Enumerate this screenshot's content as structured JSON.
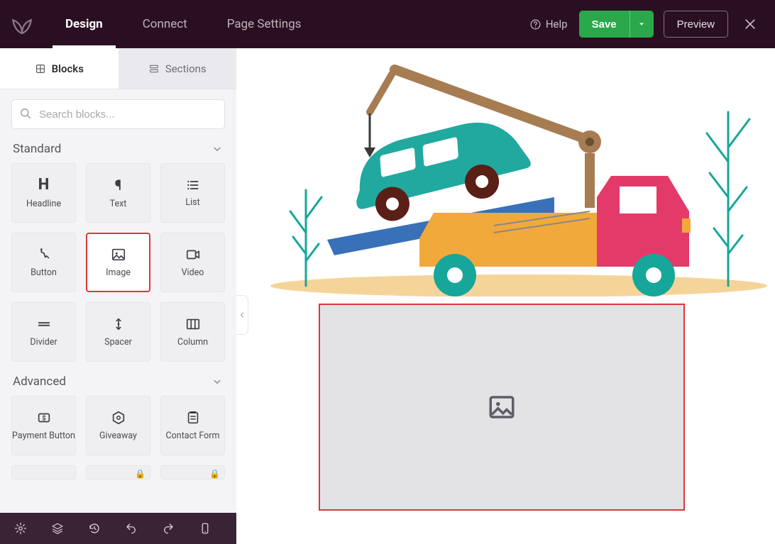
{
  "topbar": {
    "tabs": {
      "design": "Design",
      "connect": "Connect",
      "settings": "Page Settings"
    },
    "help": "Help",
    "save": "Save",
    "preview": "Preview"
  },
  "sidebar": {
    "tabs": {
      "blocks": "Blocks",
      "sections": "Sections"
    },
    "search_placeholder": "Search blocks...",
    "groups": {
      "standard": {
        "title": "Standard",
        "blocks": {
          "headline": "Headline",
          "text": "Text",
          "list": "List",
          "button": "Button",
          "image": "Image",
          "video": "Video",
          "divider": "Divider",
          "spacer": "Spacer",
          "column": "Column"
        }
      },
      "advanced": {
        "title": "Advanced",
        "blocks": {
          "payment_button": "Payment Button",
          "giveaway": "Giveaway",
          "contact_form": "Contact Form"
        }
      }
    }
  },
  "canvas": {
    "placeholder_alt": "Image placeholder"
  }
}
